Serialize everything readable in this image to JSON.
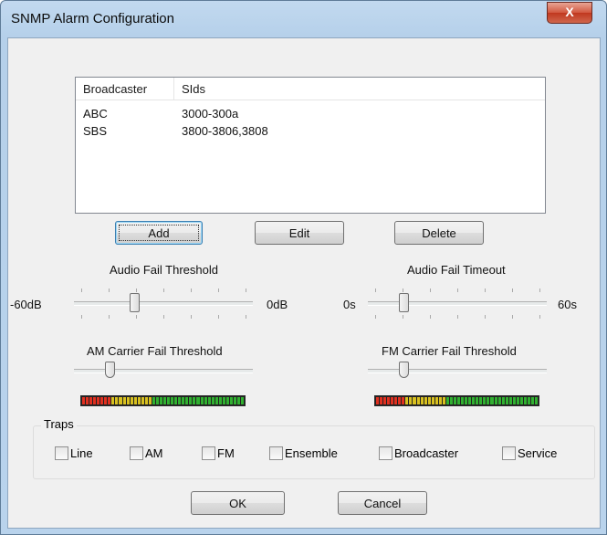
{
  "window": {
    "title": "SNMP Alarm Configuration",
    "close_glyph": "X"
  },
  "list": {
    "columns": [
      "Broadcaster",
      "SIds"
    ],
    "rows": [
      {
        "broadcaster": "ABC",
        "sids": "3000-300a"
      },
      {
        "broadcaster": "SBS",
        "sids": "3800-3806,3808"
      }
    ]
  },
  "buttons": {
    "add": "Add",
    "edit": "Edit",
    "delete": "Delete",
    "ok": "OK",
    "cancel": "Cancel"
  },
  "sliders": {
    "audio_fail_threshold": {
      "label": "Audio Fail Threshold",
      "min": "-60dB",
      "max": "0dB",
      "value_fraction": 0.33
    },
    "audio_fail_timeout": {
      "label": "Audio Fail Timeout",
      "min": "0s",
      "max": "60s",
      "value_fraction": 0.2
    },
    "am_carrier_fail_threshold": {
      "label": "AM Carrier Fail Threshold",
      "value_fraction": 0.2
    },
    "fm_carrier_fail_threshold": {
      "label": "FM Carrier Fail Threshold",
      "value_fraction": 0.2
    }
  },
  "traps": {
    "title": "Traps",
    "items": [
      {
        "label": "Line",
        "checked": false
      },
      {
        "label": "AM",
        "checked": false
      },
      {
        "label": "FM",
        "checked": false
      },
      {
        "label": "Ensemble",
        "checked": false
      },
      {
        "label": "Broadcaster",
        "checked": false
      },
      {
        "label": "Service",
        "checked": false
      }
    ]
  },
  "colors": {
    "meter_low": "#e03020",
    "meter_mid": "#d8c020",
    "meter_high": "#30b030",
    "title_bar": "#b9d3ec"
  }
}
